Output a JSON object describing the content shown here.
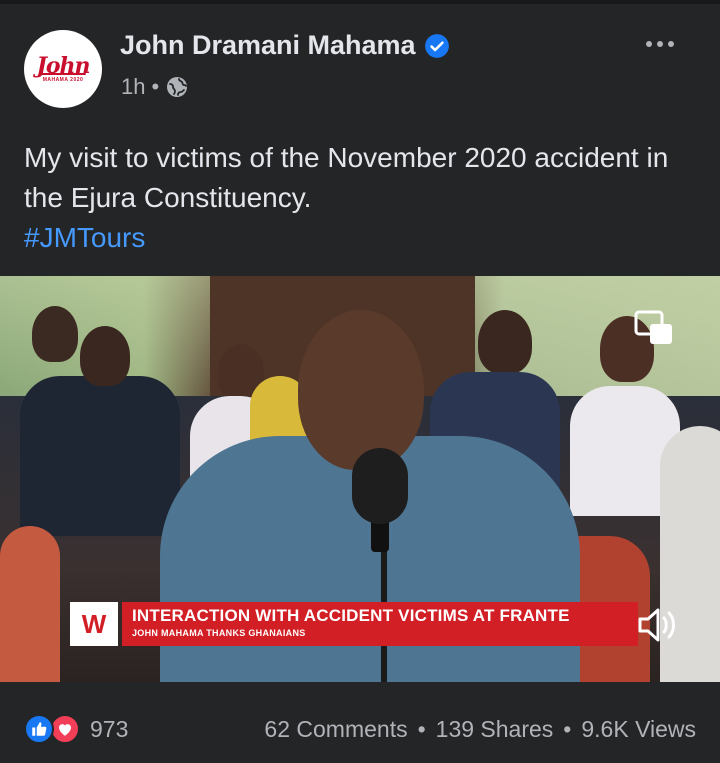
{
  "post": {
    "author": "John Dramani Mahama",
    "verified": true,
    "time": "1h",
    "separator": "•",
    "privacy_icon": "globe-icon",
    "avatar_text": "John",
    "avatar_sub": "MAHAMA 2020",
    "caption_line": "My visit to victims of the November 2020 accident in the Ejura Constituency.",
    "hashtag": "#JMTours"
  },
  "video": {
    "logo_letter": "W",
    "headline": "INTERACTION WITH ACCIDENT VICTIMS AT FRANTE",
    "subheadline": "JOHN MAHAMA THANKS GHANAIANS",
    "controls": [
      "picture-in-picture-icon",
      "speaker-icon"
    ]
  },
  "footer": {
    "reaction_count": "973",
    "comments": "62 Comments",
    "shares": "139 Shares",
    "views": "9.6K Views",
    "bullet": "•"
  },
  "colors": {
    "background": "#242526",
    "text_primary": "#e4e6eb",
    "text_secondary": "#b0b3b8",
    "link": "#4599ff",
    "verified_blue": "#1877f2",
    "lower_third_red": "#d21f26"
  }
}
